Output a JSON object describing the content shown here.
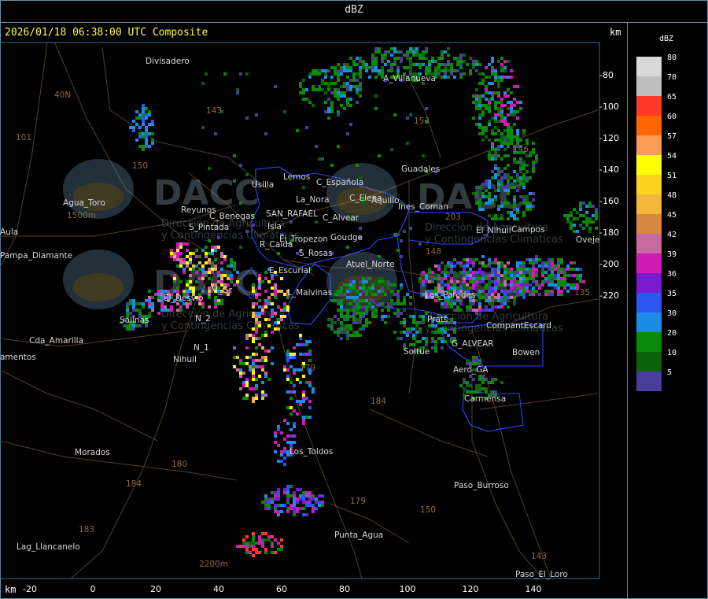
{
  "header": {
    "product": "dBZ"
  },
  "timestamp": "2026/01/18 06:38:00 UTC Composite",
  "km_label": "km",
  "axis": {
    "x_ticks": [
      "-20",
      "0",
      "20",
      "40",
      "60",
      "80",
      "100",
      "120",
      "140"
    ],
    "y_ticks": [
      "-80",
      "-100",
      "-120",
      "-140",
      "-160",
      "-180",
      "-200",
      "-220"
    ]
  },
  "watermark": {
    "logo": "DACC",
    "line1": "Dirección de Agricultura",
    "line2": "y Contingencias Climáticas"
  },
  "places": [
    "Divisadero",
    "A_Villanueva",
    "40N",
    "101",
    "143",
    "153",
    "150",
    "146",
    "Guadales",
    "Usilla",
    "Lemos",
    "C_Española",
    "C_Elena",
    "Aquillo",
    "Agua_Toro",
    "1500m",
    "Reyunos",
    "C_Benegas",
    "SAN_RAFAEL",
    "La_Nora",
    "C_Alvear",
    "Ines_Coman",
    "203",
    "S_Pintada",
    "Isla",
    "El_Tropezon",
    "Goudge",
    "El_Nihuil",
    "Campos",
    "Oveje",
    "Pampa_Diamante",
    "Aula",
    "R_Caida",
    "S_Rosas",
    "Atuel_Norte",
    "148",
    "E_Escurial",
    "M_Gr",
    "L_Malvinas",
    "El_Desvio",
    "Salinas",
    "N_2",
    "Las_Paredes",
    "Prats",
    "CompantEscard",
    "Cda_Amarilla",
    "N_1",
    "Nihuil",
    "Soitue",
    "G_ALVEAR",
    "Bowen",
    "amentos",
    "Aero_GA",
    "179",
    "184",
    "Carmensa",
    "Morados",
    "Los_Toldos",
    "180",
    "Paso_Burroso",
    "179",
    "150",
    "184",
    "183",
    "Punta_Agua",
    "Lag_Llancanelo",
    "2200m",
    "143",
    "Paso_El_Loro",
    "135"
  ],
  "legend": {
    "title": "dBZ",
    "levels": [
      {
        "label": "80",
        "color": "#d8d8d8"
      },
      {
        "label": "70",
        "color": "#bebebe"
      },
      {
        "label": "65",
        "color": "#ff3a26"
      },
      {
        "label": "60",
        "color": "#ff6600"
      },
      {
        "label": "57",
        "color": "#ff9a55"
      },
      {
        "label": "54",
        "color": "#ffff00"
      },
      {
        "label": "51",
        "color": "#ffd21e"
      },
      {
        "label": "48",
        "color": "#f2b63a"
      },
      {
        "label": "45",
        "color": "#d98840"
      },
      {
        "label": "42",
        "color": "#c86aa0"
      },
      {
        "label": "39",
        "color": "#d01ab4"
      },
      {
        "label": "36",
        "color": "#7a1ad0"
      },
      {
        "label": "35",
        "color": "#2a55ee"
      },
      {
        "label": "30",
        "color": "#1a8ce8"
      },
      {
        "label": "20",
        "color": "#0a8a0a"
      },
      {
        "label": "10",
        "color": "#0a620a"
      },
      {
        "label": "5",
        "color": "#4a3c9a"
      }
    ]
  }
}
